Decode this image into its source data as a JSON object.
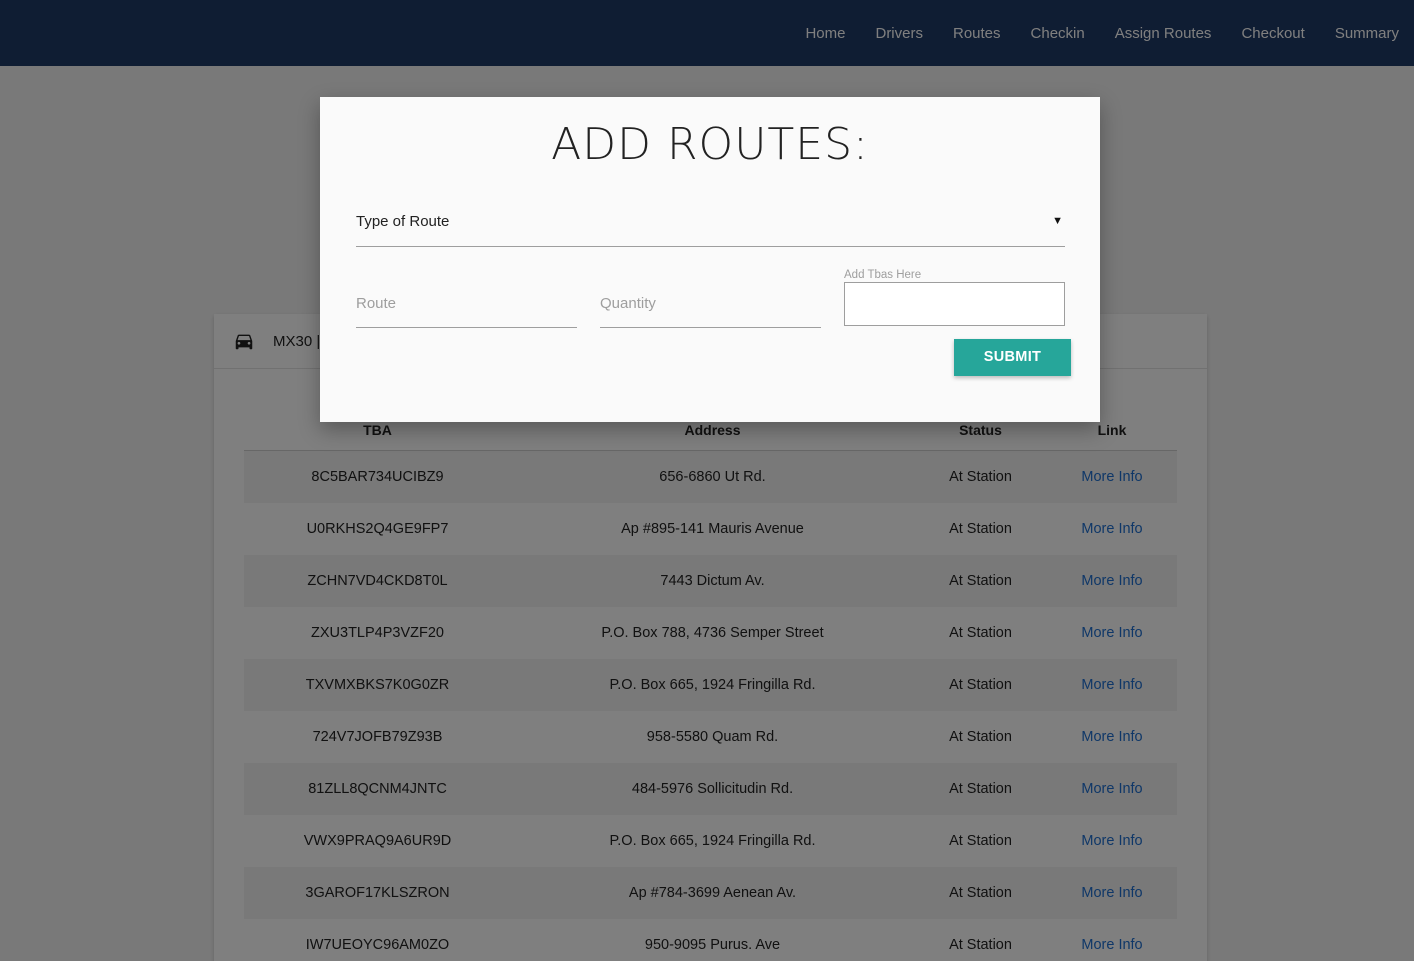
{
  "nav": {
    "items": [
      {
        "label": "Home"
      },
      {
        "label": "Drivers"
      },
      {
        "label": "Routes"
      },
      {
        "label": "Checkin"
      },
      {
        "label": "Assign Routes"
      },
      {
        "label": "Checkout"
      },
      {
        "label": "Summary"
      }
    ]
  },
  "card": {
    "icon": "car-icon",
    "title": "MX30 |"
  },
  "table": {
    "headers": [
      "TBA",
      "Address",
      "Status",
      "Link"
    ],
    "rows": [
      {
        "tba": "8C5BAR734UCIBZ9",
        "address": "656-6860 Ut Rd.",
        "status": "At Station",
        "link": "More Info"
      },
      {
        "tba": "U0RKHS2Q4GE9FP7",
        "address": "Ap #895-141 Mauris Avenue",
        "status": "At Station",
        "link": "More Info"
      },
      {
        "tba": "ZCHN7VD4CKD8T0L",
        "address": "7443 Dictum Av.",
        "status": "At Station",
        "link": "More Info"
      },
      {
        "tba": "ZXU3TLP4P3VZF20",
        "address": "P.O. Box 788, 4736 Semper Street",
        "status": "At Station",
        "link": "More Info"
      },
      {
        "tba": "TXVMXBKS7K0G0ZR",
        "address": "P.O. Box 665, 1924 Fringilla Rd.",
        "status": "At Station",
        "link": "More Info"
      },
      {
        "tba": "724V7JOFB79Z93B",
        "address": "958-5580 Quam Rd.",
        "status": "At Station",
        "link": "More Info"
      },
      {
        "tba": "81ZLL8QCNM4JNTC",
        "address": "484-5976 Sollicitudin Rd.",
        "status": "At Station",
        "link": "More Info"
      },
      {
        "tba": "VWX9PRAQ9A6UR9D",
        "address": "P.O. Box 665, 1924 Fringilla Rd.",
        "status": "At Station",
        "link": "More Info"
      },
      {
        "tba": "3GAROF17KLSZRON",
        "address": "Ap #784-3699 Aenean Av.",
        "status": "At Station",
        "link": "More Info"
      },
      {
        "tba": "IW7UEOYC96AM0ZO",
        "address": "950-9095 Purus. Ave",
        "status": "At Station",
        "link": "More Info"
      }
    ]
  },
  "modal": {
    "title": "ADD ROUTES:",
    "type_select_label": "Type of Route",
    "route_placeholder": "Route",
    "quantity_placeholder": "Quantity",
    "tbas_label": "Add Tbas Here",
    "submit_label": "SUBMIT"
  },
  "colors": {
    "navbar": "#1f3a66",
    "submit": "#26a69a",
    "link": "#1e6fd0"
  }
}
